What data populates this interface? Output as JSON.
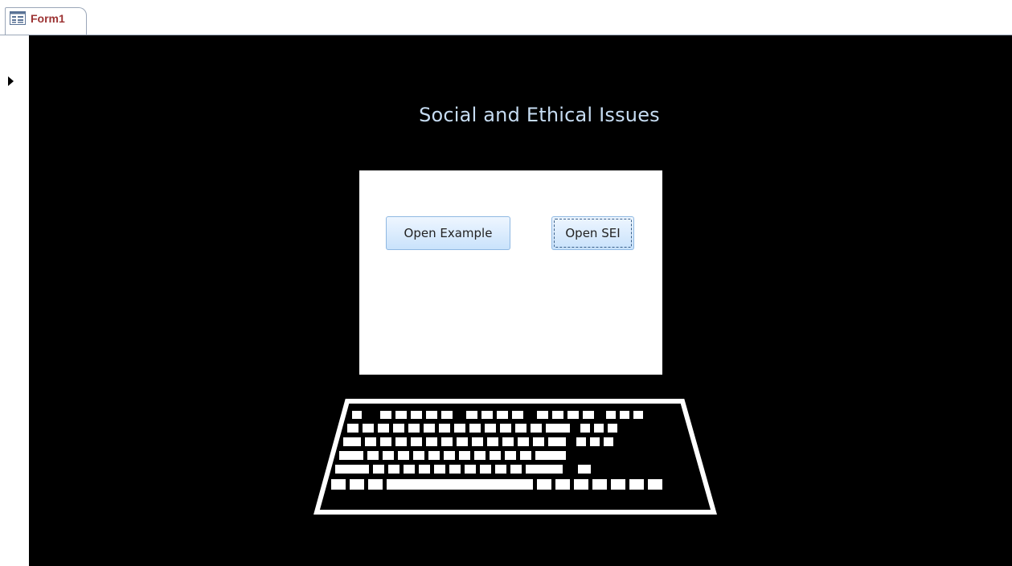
{
  "window": {
    "tab_label": "Form1",
    "tab_icon": "form-icon"
  },
  "form": {
    "title": "Social and Ethical Issues",
    "buttons": {
      "open_example": "Open Example",
      "open_sei": "Open SEI"
    },
    "focused_button": "open_sei"
  },
  "icons": {
    "record_selector": "record-pointer-icon",
    "keyboard": "keyboard-icon"
  },
  "colors": {
    "form_background": "#000000",
    "title_text": "#c6dcf2",
    "tab_label_text": "#9c3333",
    "button_fill": "#c9e2fb",
    "button_border": "#8fb8e2"
  }
}
